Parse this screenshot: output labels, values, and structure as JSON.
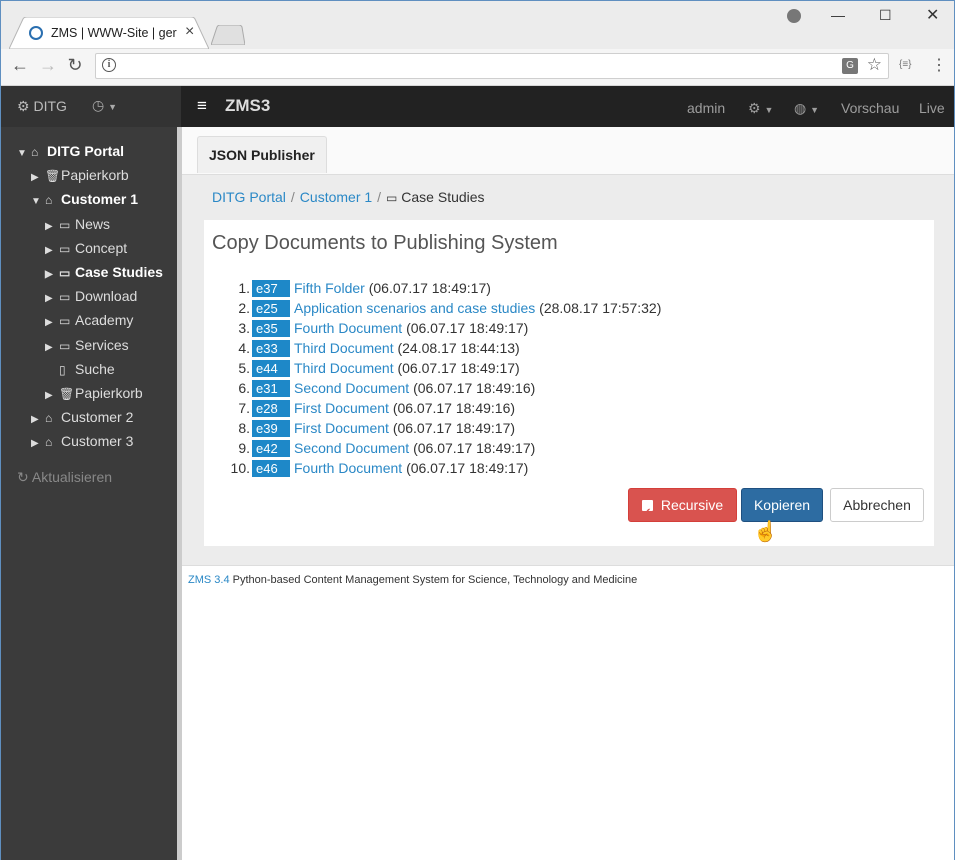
{
  "browser": {
    "tab_title": "ZMS | WWW-Site | ger",
    "url": ""
  },
  "app": {
    "site_label": "DITG",
    "brand": "ZMS3",
    "nav": {
      "user": "admin",
      "preview": "Vorschau",
      "live": "Live"
    }
  },
  "sidebar": {
    "items": [
      {
        "label": "DITG Portal",
        "icon": "home-icon"
      },
      {
        "label": "Papierkorb",
        "icon": "trash-icon"
      },
      {
        "label": "Customer 1",
        "icon": "home-icon"
      },
      {
        "label": "News",
        "icon": "folder-icon"
      },
      {
        "label": "Concept",
        "icon": "folder-icon"
      },
      {
        "label": "Case Studies",
        "icon": "folder-icon"
      },
      {
        "label": "Download",
        "icon": "folder-icon"
      },
      {
        "label": "Academy",
        "icon": "folder-icon"
      },
      {
        "label": "Services",
        "icon": "folder-icon"
      },
      {
        "label": "Suche",
        "icon": "file-icon"
      },
      {
        "label": "Papierkorb",
        "icon": "trash-icon"
      },
      {
        "label": "Customer 2",
        "icon": "home-icon"
      },
      {
        "label": "Customer 3",
        "icon": "home-icon"
      }
    ],
    "refresh_label": "Aktualisieren"
  },
  "main": {
    "tab_label": "JSON Publisher",
    "breadcrumb": {
      "root": "DITG Portal",
      "parent": "Customer 1",
      "current": "Case Studies"
    },
    "title": "Copy Documents to Publishing System",
    "documents": [
      {
        "num": "1.",
        "id": "e37",
        "title": "Fifth Folder",
        "date": "(06.07.17 18:49:17)"
      },
      {
        "num": "2.",
        "id": "e25",
        "title": "Application scenarios and case studies",
        "date": "(28.08.17 17:57:32)"
      },
      {
        "num": "3.",
        "id": "e35",
        "title": "Fourth Document",
        "date": "(06.07.17 18:49:17)"
      },
      {
        "num": "4.",
        "id": "e33",
        "title": "Third Document",
        "date": "(24.08.17 18:44:13)"
      },
      {
        "num": "5.",
        "id": "e44",
        "title": "Third Document",
        "date": "(06.07.17 18:49:17)"
      },
      {
        "num": "6.",
        "id": "e31",
        "title": "Second Document",
        "date": "(06.07.17 18:49:16)"
      },
      {
        "num": "7.",
        "id": "e28",
        "title": "First Document",
        "date": "(06.07.17 18:49:16)"
      },
      {
        "num": "8.",
        "id": "e39",
        "title": "First Document",
        "date": "(06.07.17 18:49:17)"
      },
      {
        "num": "9.",
        "id": "e42",
        "title": "Second Document",
        "date": "(06.07.17 18:49:17)"
      },
      {
        "num": "10.",
        "id": "e46",
        "title": "Fourth Document",
        "date": "(06.07.17 18:49:17)"
      }
    ],
    "buttons": {
      "recursive": "Recursive",
      "copy": "Kopieren",
      "cancel": "Abbrechen"
    }
  },
  "footer": {
    "version": "ZMS 3.4",
    "description": "Python-based Content Management System for Science, Technology and Medicine"
  },
  "colors": {
    "navbar": "#222222",
    "sidebar": "#3b3b3b",
    "link": "#2a88c6",
    "badge": "#1e88c8",
    "danger": "#d9534f",
    "primary": "#2d6ca2"
  }
}
